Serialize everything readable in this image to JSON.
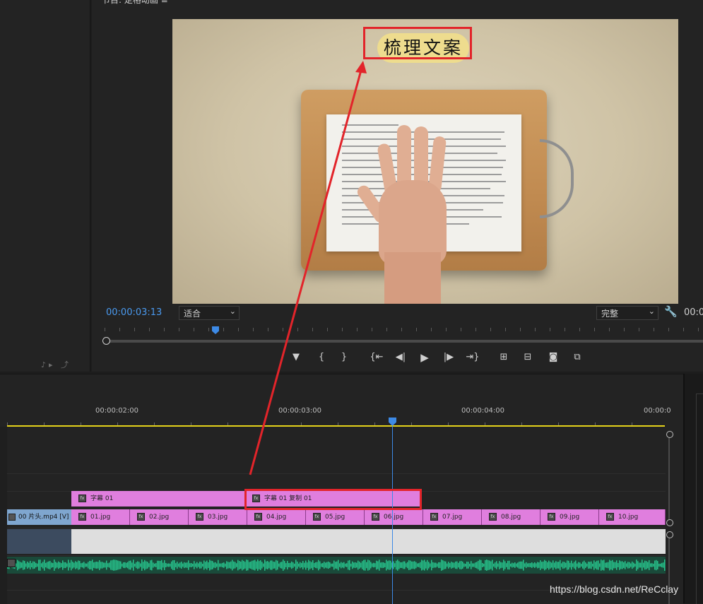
{
  "monitor": {
    "title": "节目: 定格动画 ≡",
    "title_badge": "梳理文案",
    "timecode": "00:00:03:13",
    "zoom": "适合",
    "quality": "完整",
    "timecode_right": "00:0"
  },
  "timeline": {
    "ruler_labels": [
      "00:00:02:00",
      "00:00:03:00",
      "00:00:04:00",
      "00:00:0"
    ],
    "subtitle_clips": [
      "字幕 01",
      "字幕 01 复制 01"
    ],
    "video_head": "00 片头.mp4 [V]",
    "image_clips": [
      "01.jpg",
      "02.jpg",
      "03.jpg",
      "04.jpg",
      "05.jpg",
      "06.jpg",
      "07.jpg",
      "08.jpg",
      "09.jpg",
      "10.jpg"
    ]
  },
  "icons": {
    "wrench": "wrench-icon",
    "play": "play-icon",
    "camera": "camera-icon"
  },
  "colors": {
    "accent_timecode": "#4a9af0",
    "playhead": "#3d8ae6",
    "clip_pink": "#e07ede",
    "work_area": "#e4d21a",
    "annotation_red": "#e2242a"
  },
  "watermark": "https://blog.csdn.net/ReCclay"
}
